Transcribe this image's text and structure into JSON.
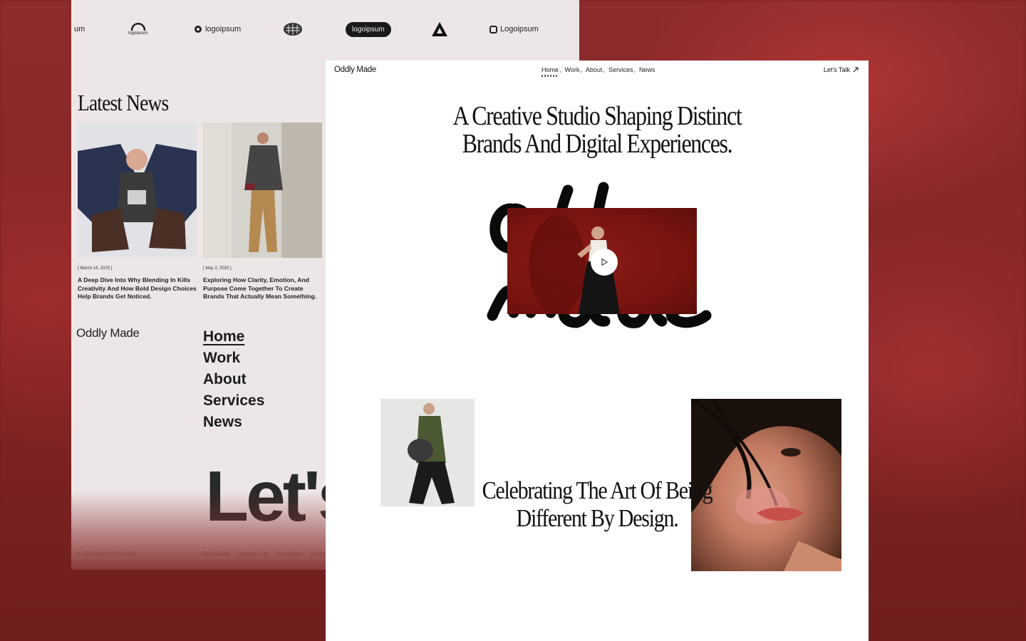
{
  "logo_strip": [
    {
      "name": "logoipsum-partial-logo",
      "text": "um"
    },
    {
      "name": "logoipsum-arch-logo",
      "text": "logoipsum"
    },
    {
      "name": "logoipsum-gear-logo",
      "text": "logoipsum"
    },
    {
      "name": "logoipsum-circle-logo",
      "text": ""
    },
    {
      "name": "logoipsum-pill-logo",
      "text": "logoipsum"
    },
    {
      "name": "logoipsum-triangle-logo",
      "text": ""
    },
    {
      "name": "logoipsum-square-logo",
      "text": "Logoipsum"
    }
  ],
  "latest_news": {
    "title": "Latest News",
    "articles": [
      {
        "date": "[ March 14, 2025 ]",
        "title": "A Deep Dive Into Why Blending In Kills Creativity And How Bold Design Choices Help Brands Get Noticed."
      },
      {
        "date": "[ May 2, 2025 ]",
        "title": "Exploring How Clarity, Emotion, And Purpose Come Together To Create Brands That Actually Mean Something."
      }
    ]
  },
  "footer": {
    "brand": "Oddly Made",
    "nav": [
      "Home",
      "Work",
      "About",
      "Services",
      "News"
    ],
    "cta_big": "Let's",
    "copyright": "© 2025 built by Pixelflix",
    "links": [
      "Style Guide",
      "Change Log",
      "Instruction",
      "Licen"
    ]
  },
  "header": {
    "brand": "Oddly Made",
    "nav": [
      {
        "label": "Home",
        "sep": ","
      },
      {
        "label": "Work",
        "sep": ","
      },
      {
        "label": "About",
        "sep": ","
      },
      {
        "label": "Services",
        "sep": ","
      },
      {
        "label": "News",
        "sep": ""
      }
    ],
    "cta": "Let's Talk",
    "cta_icon": "arrow-up-right-icon"
  },
  "hero": {
    "title_line1": "A Creative Studio Shaping Distinct",
    "title_line2": "Brands And Digital Experiences.",
    "play_icon": "play-icon"
  },
  "section": {
    "tagline_line1": "Celebrating The Art Of Being",
    "tagline_line2": "Different By Design."
  },
  "colors": {
    "accent_red": "#7a1410",
    "page_bg": "#ede6e6",
    "text": "#111111"
  }
}
